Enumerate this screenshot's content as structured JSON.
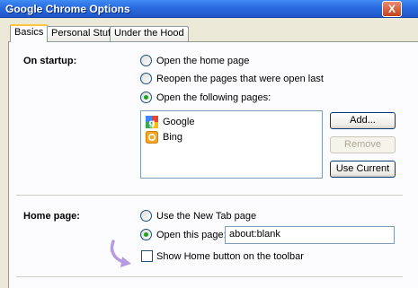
{
  "window": {
    "title": "Google Chrome Options",
    "close_label": "X"
  },
  "tabs": [
    {
      "label": "Basics",
      "active": true
    },
    {
      "label": "Personal Stuff",
      "active": false
    },
    {
      "label": "Under the Hood",
      "active": false
    }
  ],
  "startup": {
    "section_label": "On startup:",
    "options": [
      {
        "label": "Open the home page",
        "selected": false
      },
      {
        "label": "Reopen the pages that were open last",
        "selected": false
      },
      {
        "label": "Open the following pages:",
        "selected": true
      }
    ],
    "pages": [
      {
        "label": "Google",
        "icon": "google-favicon"
      },
      {
        "label": "Bing",
        "icon": "bing-favicon"
      }
    ],
    "buttons": {
      "add": "Add...",
      "remove": "Remove",
      "use_current": "Use Current"
    },
    "remove_enabled": false
  },
  "homepage": {
    "section_label": "Home page:",
    "options": [
      {
        "label": "Use the New Tab page",
        "selected": false
      },
      {
        "label": "Open this page:",
        "selected": true
      }
    ],
    "url_value": "about:blank",
    "show_home_button_label": "Show Home button on the toolbar",
    "show_home_button_checked": false
  },
  "colors": {
    "titlebar": "#2A6BE0",
    "selected_radio": "#21A121",
    "arrow": "#B59CE0"
  },
  "icons": [
    "close-icon",
    "google-favicon",
    "bing-favicon",
    "curved-arrow-icon"
  ]
}
